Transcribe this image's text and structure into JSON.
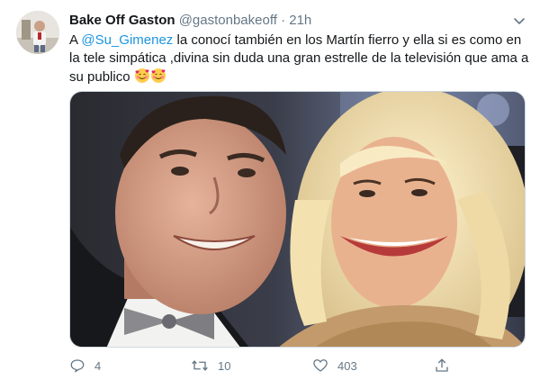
{
  "tweet": {
    "author_name": "Bake Off Gaston",
    "author_handle": "@gastonbakeoff",
    "separator": "·",
    "time": "21h",
    "text_prefix": "A ",
    "mention": "@Su_Gimenez",
    "text_body": " la conocí también en los Martín fierro y ella si es como en la tele simpática ,divina sin duda una gran estrelle de la televisión que ama a su publico ",
    "emojis": [
      "smiling-face-with-hearts",
      "smiling-face-with-hearts"
    ],
    "image_alt": "Selfie photo of two people at an awards event"
  },
  "actions": {
    "reply_count": "4",
    "retweet_count": "10",
    "like_count": "403",
    "share_label": ""
  },
  "colors": {
    "link": "#1b95e0",
    "muted": "#657786",
    "text": "#14171a"
  },
  "icons": {
    "menu": "chevron-down-icon",
    "reply": "comment-icon",
    "retweet": "retweet-icon",
    "like": "heart-icon",
    "share": "share-icon"
  }
}
